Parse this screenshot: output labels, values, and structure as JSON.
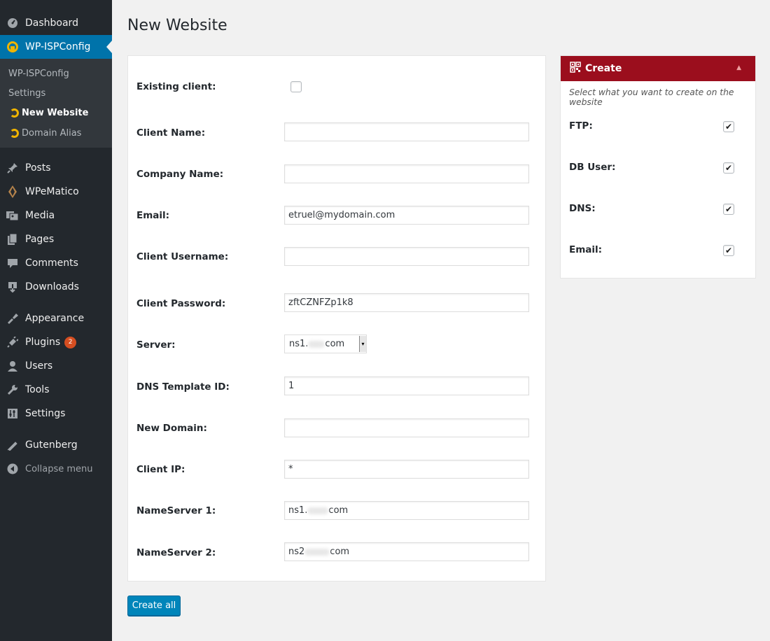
{
  "sidebar": {
    "items": [
      {
        "label": "Dashboard",
        "icon": "dashboard-icon"
      },
      {
        "label": "WP-ISPConfig",
        "icon": "ispconfig-icon"
      },
      {
        "label": "Posts",
        "icon": "pin-icon"
      },
      {
        "label": "WPeMatico",
        "icon": "wpematico-icon"
      },
      {
        "label": "Media",
        "icon": "media-icon"
      },
      {
        "label": "Pages",
        "icon": "pages-icon"
      },
      {
        "label": "Comments",
        "icon": "comments-icon"
      },
      {
        "label": "Downloads",
        "icon": "downloads-icon"
      },
      {
        "label": "Appearance",
        "icon": "appearance-icon"
      },
      {
        "label": "Plugins",
        "icon": "plugins-icon",
        "badge": "2"
      },
      {
        "label": "Users",
        "icon": "users-icon"
      },
      {
        "label": "Tools",
        "icon": "tools-icon"
      },
      {
        "label": "Settings",
        "icon": "settings-icon"
      },
      {
        "label": "Gutenberg",
        "icon": "gutenberg-icon"
      },
      {
        "label": "Collapse menu",
        "icon": "collapse-icon"
      }
    ],
    "submenu": [
      {
        "label": "WP-ISPConfig"
      },
      {
        "label": "Settings"
      },
      {
        "label": "New Website"
      },
      {
        "label": "Domain Alias"
      }
    ]
  },
  "page": {
    "title": "New Website"
  },
  "form": {
    "existing_client_label": "Existing client:",
    "client_name_label": "Client Name:",
    "client_name_value": "",
    "company_name_label": "Company Name:",
    "company_name_value": "",
    "email_label": "Email:",
    "email_value": "etruel@mydomain.com",
    "client_username_label": "Client Username:",
    "client_username_value": "",
    "client_password_label": "Client Password:",
    "client_password_value": "zftCZNFZp1k8",
    "server_label": "Server:",
    "server_value_prefix": "ns1.",
    "server_value_suffix": "com",
    "dns_template_label": "DNS Template ID:",
    "dns_template_value": "1",
    "new_domain_label": "New Domain:",
    "new_domain_value": "",
    "client_ip_label": "Client IP:",
    "client_ip_value": "*",
    "nameserver1_label": "NameServer 1:",
    "nameserver1_prefix": "ns1.",
    "nameserver1_suffix": "com",
    "nameserver2_label": "NameServer 2:",
    "nameserver2_prefix": "ns2",
    "nameserver2_suffix": "com",
    "submit_label": "Create all"
  },
  "create_box": {
    "title": "Create",
    "description": "Select what you want to create on the website",
    "options": [
      {
        "label": "FTP:",
        "checked": true
      },
      {
        "label": "DB User:",
        "checked": true
      },
      {
        "label": "DNS:",
        "checked": true
      },
      {
        "label": "Email:",
        "checked": true
      }
    ]
  },
  "colors": {
    "sidebar_bg": "#23282d",
    "active_menu": "#0073aa",
    "create_header": "#9b0e1d",
    "button": "#0085ba"
  }
}
